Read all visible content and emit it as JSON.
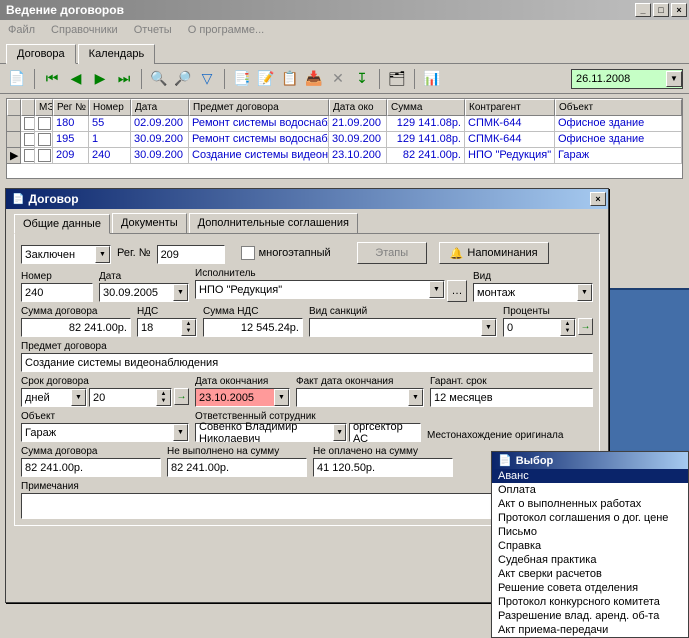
{
  "main": {
    "title": "Ведение договоров",
    "menu": [
      "Файл",
      "Справочники",
      "Отчеты",
      "О программе..."
    ],
    "tabs": [
      "Договора",
      "Календарь"
    ],
    "active_tab": 0,
    "date_filter": "26.11.2008"
  },
  "grid": {
    "headers": [
      "",
      "",
      "МЭ",
      "Рег №",
      "Номер",
      "Дата",
      "Предмет договора",
      "Дата око",
      "Сумма",
      "Контрагент",
      "Объект"
    ],
    "rows": [
      {
        "ind": "",
        "reg": "180",
        "num": "55",
        "date": "02.09.200",
        "subj": "Ремонт системы водоснабж",
        "end": "21.09.200",
        "sum": "129 141.08р.",
        "agent": "СПМК-644",
        "obj": "Офисное здание"
      },
      {
        "ind": "",
        "reg": "195",
        "num": "1",
        "date": "30.09.200",
        "subj": "Ремонт системы водоснабж",
        "end": "30.09.200",
        "sum": "129 141.08р.",
        "agent": "СПМК-644",
        "obj": "Офисное здание"
      },
      {
        "ind": "▶",
        "reg": "209",
        "num": "240",
        "date": "30.09.200",
        "subj": "Создание системы видеона",
        "end": "23.10.200",
        "sum": "82 241.00р.",
        "agent": "НПО \"Редукция\"",
        "obj": "Гараж"
      }
    ]
  },
  "dialog": {
    "title": "Договор",
    "tabs": [
      "Общие данные",
      "Документы",
      "Дополнительные соглашения"
    ],
    "active_tab": 0,
    "status": "Заключен",
    "reg_label": "Рег. №",
    "reg_no": "209",
    "multistage": "многоэтапный",
    "stages_btn": "Этапы",
    "reminders_btn": "Напоминания",
    "number_label": "Номер",
    "number": "240",
    "date_label": "Дата",
    "date": "30.09.2005",
    "executor_label": "Исполнитель",
    "executor": "НПО \"Редукция\"",
    "kind_label": "Вид",
    "kind": "монтаж",
    "sum_label": "Сумма договора",
    "sum": "82 241.00р.",
    "vat_label": "НДС",
    "vat": "18",
    "vat_sum_label": "Сумма НДС",
    "vat_sum": "12 545.24р.",
    "sanction_label": "Вид санкций",
    "sanction": "",
    "percent_label": "Проценты",
    "percent": "0",
    "subject_label": "Предмет договора",
    "subject": "Создание системы видеонаблюдения",
    "term_label": "Срок договора",
    "term_unit": "дней",
    "term_val": "20",
    "end_label": "Дата окончания",
    "end": "23.10.2005",
    "fact_end_label": "Факт дата окончания",
    "fact_end": "",
    "warranty_label": "Гарант. срок",
    "warranty": "12 месяцев",
    "object_label": "Объект",
    "object": "Гараж",
    "responsible_label": "Ответственный сотрудник",
    "responsible": "Совенко Владимир  Николаевич",
    "orgsector": "оргсектор АС",
    "orig_loc_label": "Местонахождение оригинала",
    "sum2_label": "Сумма договора",
    "sum2": "82 241.00р.",
    "not_done_label": "Не выполнено на сумму",
    "not_done": "82 241.00р.",
    "not_paid_label": "Не оплачено на сумму",
    "not_paid": "41 120.50р.",
    "note_label": "Примечания"
  },
  "popup": {
    "title": "Выбор",
    "items": [
      "Аванс",
      "Оплата",
      "Акт о выполненных работах",
      "Протокол соглашения о дог. цене",
      "Письмо",
      "Справка",
      "Судебная практика",
      "Акт сверки расчетов",
      "Решение совета отделения",
      "Протокол конкурсного комитета",
      "Разрешение влад. аренд. об-та",
      "Акт приема-передачи"
    ],
    "selected": 0
  }
}
